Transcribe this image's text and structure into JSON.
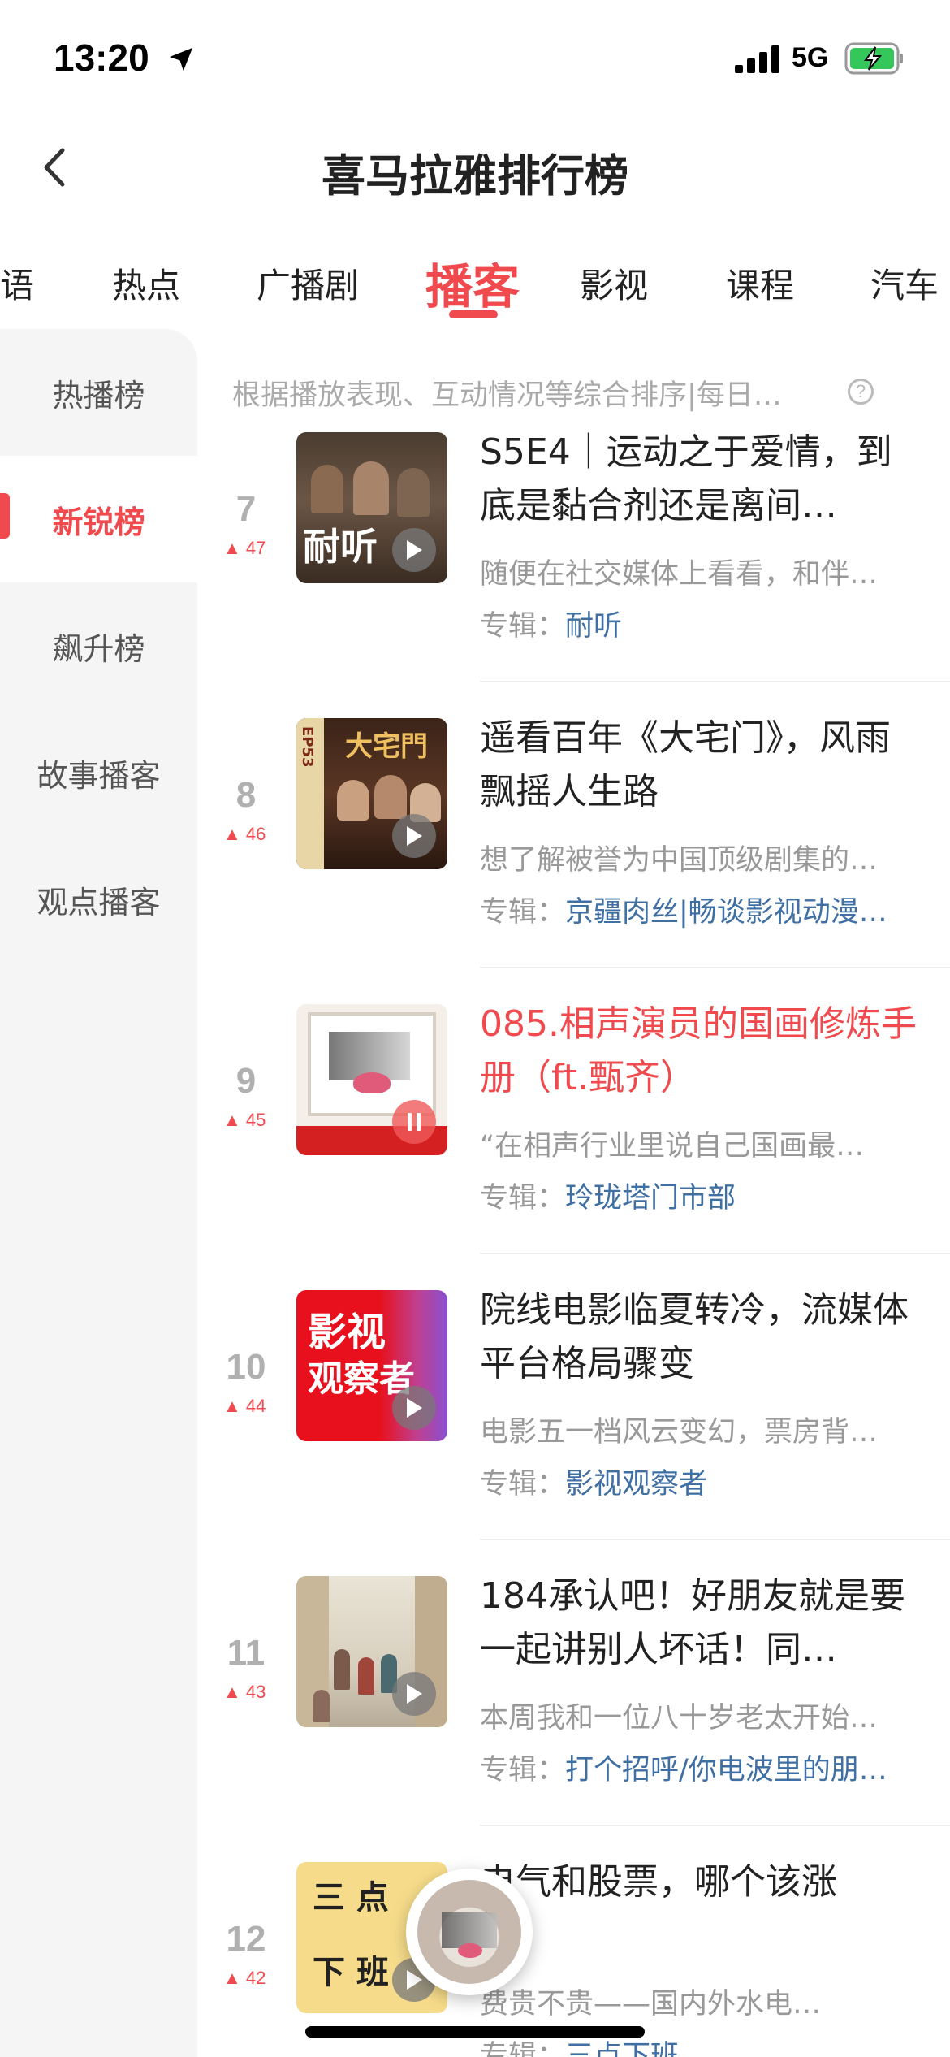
{
  "status": {
    "time": "13:20",
    "network": "5G"
  },
  "header": {
    "title": "喜马拉雅排行榜"
  },
  "categories": [
    "语",
    "热点",
    "广播剧",
    "播客",
    "影视",
    "课程",
    "汽车"
  ],
  "sidebar": [
    "热播榜",
    "新锐榜",
    "飙升榜",
    "故事播客",
    "观点播客"
  ],
  "hint": "根据播放表现、互动情况等综合排序|每日…",
  "album_label": "专辑：",
  "items": [
    {
      "rank": "7",
      "change": "▲ 47",
      "title": "S5E4｜运动之于爱情，到底是黏合剂还是离间…",
      "desc": "随便在社交媒体上看看，和伴…",
      "album": "耐听",
      "cover_text": "耐听"
    },
    {
      "rank": "8",
      "change": "▲ 46",
      "title": "遥看百年《大宅门》，风雨飘摇人生路",
      "desc": "想了解被誉为中国顶级剧集的…",
      "album": "京疆肉丝|畅谈影视动漫…",
      "cover_text": "大宅門",
      "cover_side": "EP53"
    },
    {
      "rank": "9",
      "change": "▲ 45",
      "title": "085.相声演员的国画修炼手册（ft.甄齐）",
      "desc": "“在相声行业里说自己国画最…",
      "album": "玲珑塔门市部"
    },
    {
      "rank": "10",
      "change": "▲ 44",
      "title": "院线电影临夏转冷，流媒体平台格局骤变",
      "desc": "电影五一档风云变幻，票房背…",
      "album": "影视观察者",
      "cover_text_1": "影视",
      "cover_text_2": "观察者"
    },
    {
      "rank": "11",
      "change": "▲ 43",
      "title": "184承认吧！好朋友就是要一起讲别人坏话！同…",
      "desc": "本周我和一位八十岁老太开始…",
      "album": "打个招呼/你电波里的朋…"
    },
    {
      "rank": "12",
      "change": "▲ 42",
      "title": "电气和股票，哪个该涨",
      "desc": "费贵不贵——国内外水电…",
      "album": "三点下班",
      "cover_text_1": "三  点",
      "cover_text_2": "下  班"
    }
  ]
}
